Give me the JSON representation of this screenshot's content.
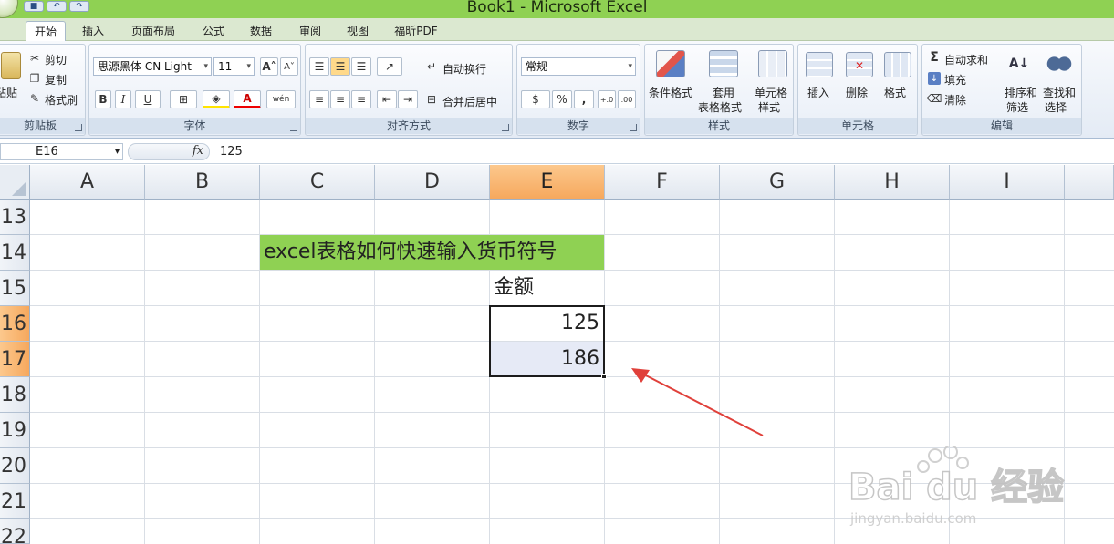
{
  "window": {
    "title": "Book1 - Microsoft Excel"
  },
  "tabs": [
    "开始",
    "插入",
    "页面布局",
    "公式",
    "数据",
    "审阅",
    "视图",
    "福昕PDF"
  ],
  "clipboard": {
    "paste": "粘贴",
    "cut": "剪切",
    "copy": "复制",
    "format_painter": "格式刷",
    "label": "剪贴板"
  },
  "font": {
    "name": "思源黑体 CN Light",
    "size": "11",
    "label": "字体",
    "bold": "B",
    "italic": "I",
    "underline": "U",
    "phonetic": "wén"
  },
  "alignment": {
    "wrap": "自动换行",
    "merge": "合并后居中",
    "label": "对齐方式"
  },
  "number": {
    "format": "常规",
    "label": "数字",
    "percent": "%",
    "comma": ",",
    "inc": "+.0",
    "dec": ".00"
  },
  "styles": {
    "conditional": "条件格式",
    "table1": "套用",
    "table2": "表格格式",
    "cell1": "单元格",
    "cell2": "样式",
    "label": "样式"
  },
  "cells_group": {
    "insert": "插入",
    "delete": "删除",
    "format": "格式",
    "label": "单元格"
  },
  "editing": {
    "autosum": "自动求和",
    "fill": "填充",
    "clear": "清除",
    "sort1": "排序和",
    "sort2": "筛选",
    "find1": "查找和",
    "find2": "选择",
    "label": "编辑"
  },
  "formula_bar": {
    "name_box": "E16",
    "fx": "fx",
    "content": "125"
  },
  "columns": [
    "A",
    "B",
    "C",
    "D",
    "E",
    "F",
    "G",
    "H",
    "I"
  ],
  "rows": [
    "13",
    "14",
    "15",
    "16",
    "17",
    "18",
    "19",
    "20",
    "21",
    "22"
  ],
  "sheet": {
    "title_cell": "excel表格如何快速输入货币符号",
    "header_cell": "金额",
    "values": [
      "125",
      "186"
    ]
  },
  "watermark": {
    "brand": "Bai du 经验",
    "url": "jingyan.baidu.com"
  },
  "colors": {
    "accent_green": "#8fd153",
    "selected_header": "#f6a85d",
    "annotation_arrow": "#e0403a"
  }
}
